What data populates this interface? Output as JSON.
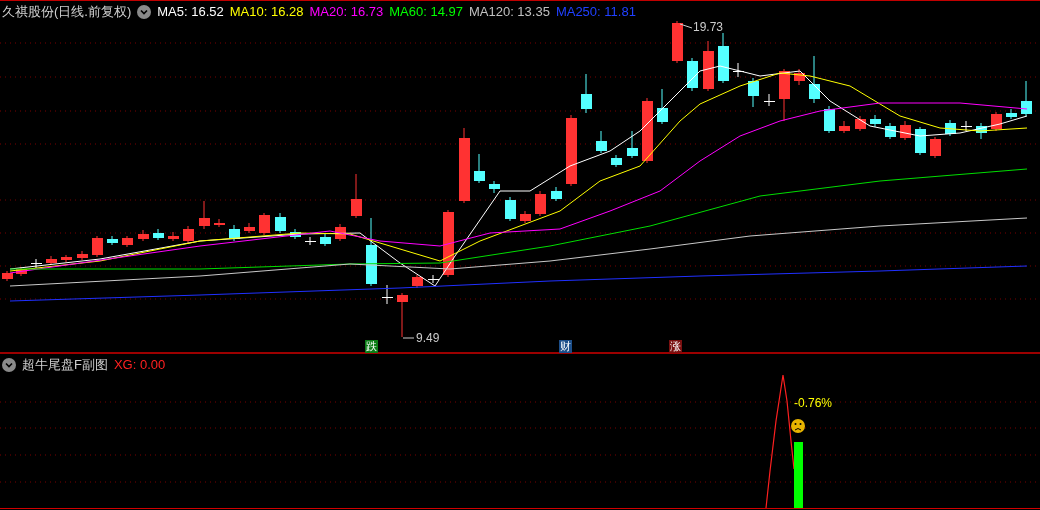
{
  "main_chart": {
    "title": "久祺股份(日线.前复权)",
    "indicators": [
      {
        "label": "MA5: 16.52",
        "color": "#ffffff"
      },
      {
        "label": "MA10: 16.28",
        "color": "#ffff00"
      },
      {
        "label": "MA20: 16.73",
        "color": "#ff00ff"
      },
      {
        "label": "MA60: 14.97",
        "color": "#00ff00"
      },
      {
        "label": "MA120: 13.35",
        "color": "#c0c0c0"
      },
      {
        "label": "MA250: 11.81",
        "color": "#2040ff"
      }
    ],
    "price_labels": [
      {
        "kind": "high",
        "text": "19.73"
      },
      {
        "kind": "low",
        "text": "9.49"
      }
    ],
    "markers": [
      {
        "text": "跌",
        "color": "#0b7d16"
      },
      {
        "text": "财",
        "color": "#1d4f8a"
      },
      {
        "text": "涨",
        "color": "#7a1010"
      }
    ]
  },
  "sub_chart": {
    "title": "超牛尾盘F副图",
    "reading": "XG: 0.00",
    "value_label": "-0.76%"
  }
}
